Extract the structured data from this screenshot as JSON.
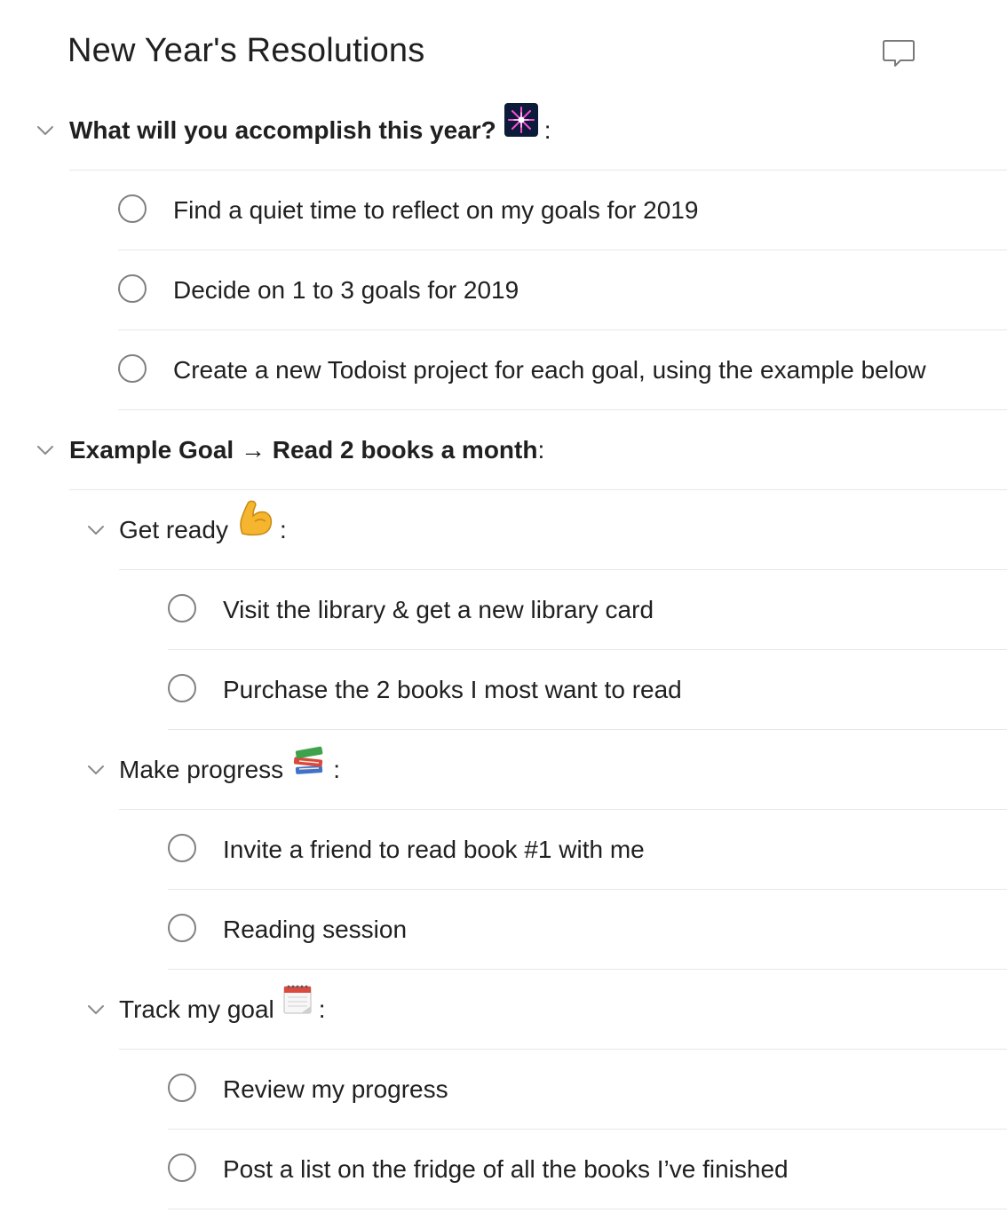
{
  "project": {
    "title": "New Year's Resolutions",
    "comment_icon": "comment-icon"
  },
  "sections": [
    {
      "title": "What will you accomplish this year?",
      "emoji": "fireworks-icon",
      "suffix": ":",
      "bold": true,
      "tasks": [
        "Find a quiet time to reflect on my goals for 2019",
        "Decide on 1 to 3 goals for 2019",
        "Create a new Todoist project for each goal, using the example below"
      ]
    },
    {
      "title": "Example Goal → Read 2 books a month",
      "suffix": ":",
      "bold": true,
      "subsections": [
        {
          "title": "Get ready",
          "emoji": "flexed-biceps-icon",
          "suffix": ":",
          "tasks": [
            "Visit the library & get a new library card",
            "Purchase the 2 books I most want to read"
          ]
        },
        {
          "title": "Make progress",
          "emoji": "books-icon",
          "suffix": ":",
          "tasks": [
            "Invite a friend to read book #1 with me",
            "Reading session"
          ]
        },
        {
          "title": "Track my goal",
          "emoji": "spiral-calendar-icon",
          "suffix": ":",
          "tasks": [
            "Review my progress",
            "Post a list on the fridge of all the books I’ve finished"
          ]
        }
      ]
    }
  ],
  "colors": {
    "text": "#202020",
    "divider": "#e7e7e7",
    "checkbox_border": "#808080",
    "chevron": "#8a8a8a"
  }
}
